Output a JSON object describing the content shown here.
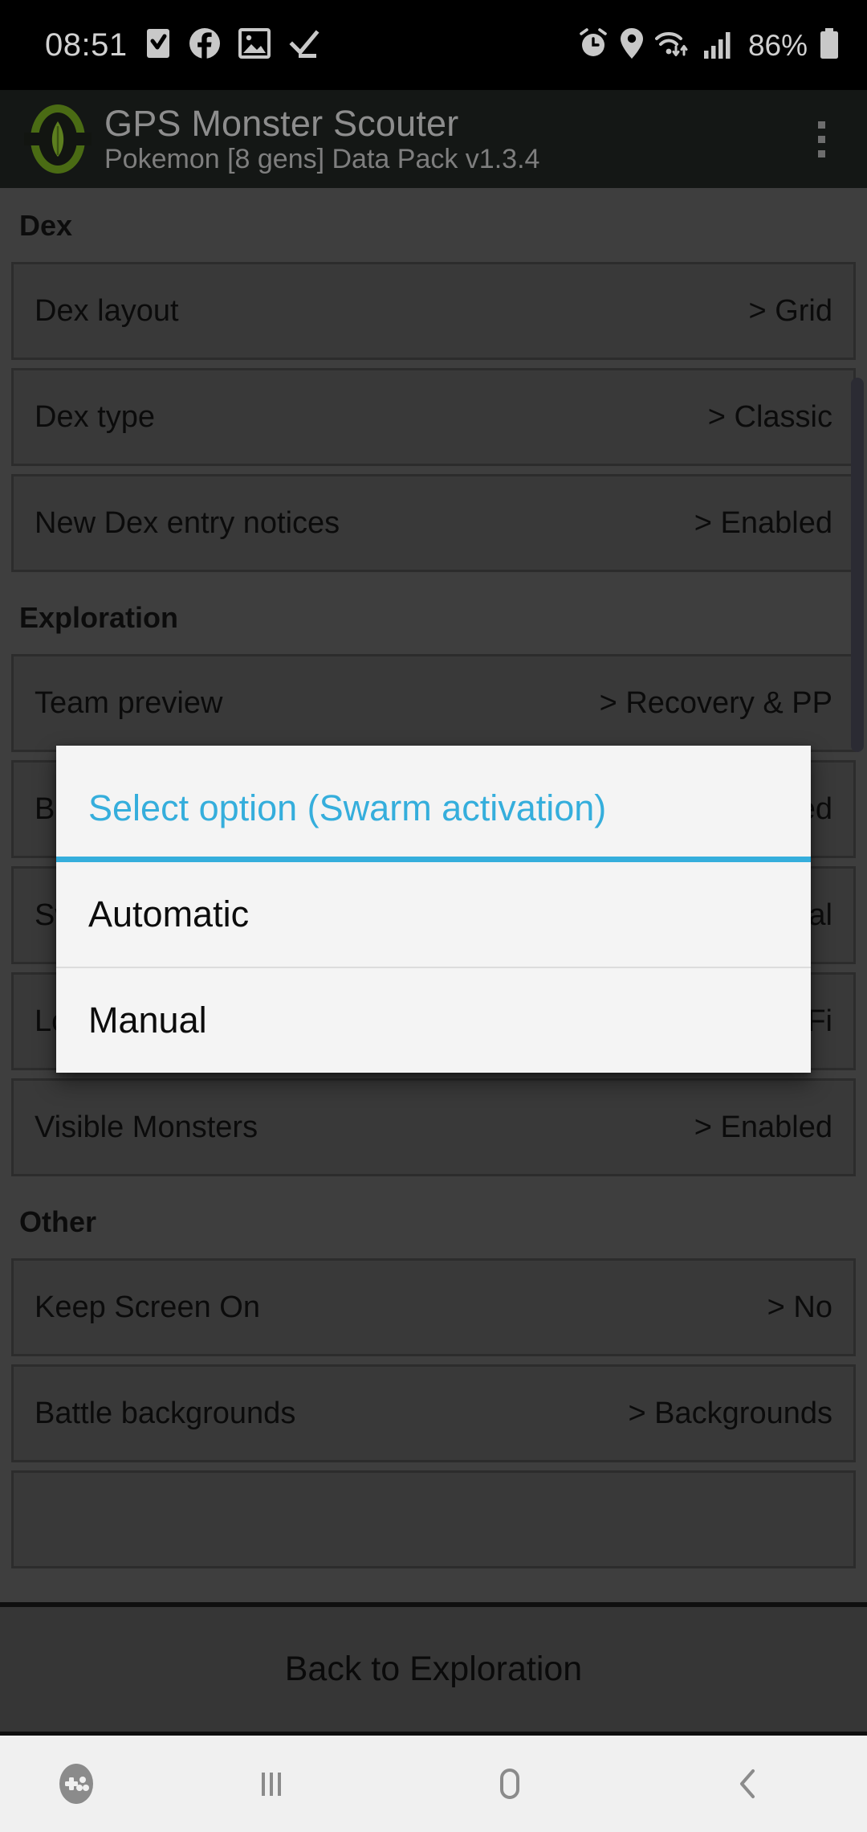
{
  "status_bar": {
    "time": "08:51",
    "battery_percent": "86%",
    "left_icons": [
      "tasks-checkbox-icon",
      "facebook-icon",
      "gallery-image-icon",
      "check-underline-icon"
    ],
    "right_icons": [
      "alarm-icon",
      "location-pin-icon",
      "wifi-transfer-icon",
      "signal-bars-icon"
    ],
    "battery_icon": "battery-icon"
  },
  "app_bar": {
    "title": "GPS Monster Scouter",
    "subtitle": "Pokemon [8 gens] Data Pack v1.3.4",
    "logo_icon": "app-logo-icon",
    "overflow_icon": "overflow-menu-icon"
  },
  "settings": {
    "groups": [
      {
        "header": "Dex",
        "rows": [
          {
            "title": "Dex layout",
            "value": "> Grid"
          },
          {
            "title": "Dex type",
            "value": "> Classic"
          },
          {
            "title": "New Dex entry notices",
            "value": "> Enabled"
          }
        ]
      },
      {
        "header": "Exploration",
        "rows": [
          {
            "title": "Team preview",
            "value": "> Recovery & PP"
          },
          {
            "title": "Berries",
            "value": "> Enabled"
          },
          {
            "title": "Swarm activation",
            "value": "> Manual"
          },
          {
            "title": "Location Tracking",
            "value": "> Sat. & Wi-Fi"
          },
          {
            "title": "Visible Monsters",
            "value": "> Enabled"
          }
        ]
      },
      {
        "header": "Other",
        "rows": [
          {
            "title": "Keep Screen On",
            "value": "> No"
          },
          {
            "title": "Battle backgrounds",
            "value": "> Backgrounds"
          },
          {
            "title": "",
            "value": ""
          }
        ]
      }
    ]
  },
  "dialog": {
    "title": "Select option (Swarm activation)",
    "accent_color": "#35aedc",
    "options": [
      "Automatic",
      "Manual"
    ]
  },
  "bottom_bar": {
    "label": "Back to Exploration"
  },
  "nav_bar": {
    "items": [
      "gamepad-icon",
      "recents-icon",
      "home-icon",
      "back-icon"
    ]
  }
}
